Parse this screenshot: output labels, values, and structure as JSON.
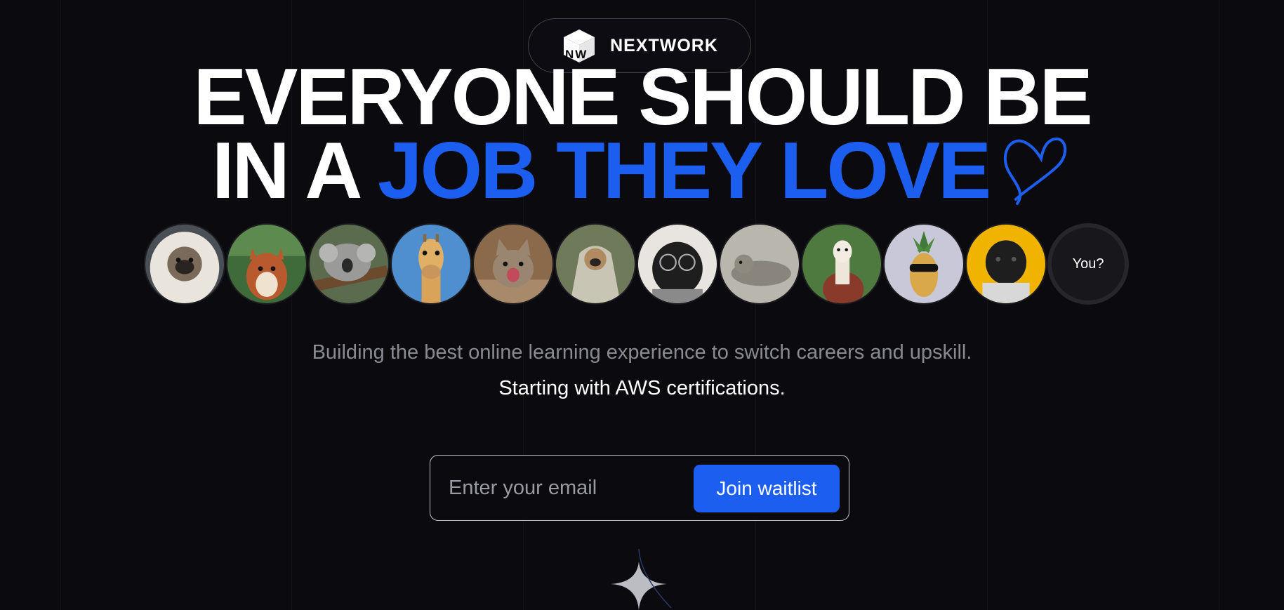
{
  "brand": {
    "name": "NEXTWORK",
    "mark_letters": "NW"
  },
  "hero": {
    "line1": "EVERYONE SHOULD BE",
    "line2_prefix": "IN A ",
    "line2_highlight": "JOB THEY LOVE"
  },
  "avatars": [
    {
      "name": "pug-in-fur-hood"
    },
    {
      "name": "squirrel"
    },
    {
      "name": "sleeping-koala"
    },
    {
      "name": "giraffe"
    },
    {
      "name": "yawning-kitten"
    },
    {
      "name": "pug-in-blanket"
    },
    {
      "name": "pug-with-glasses"
    },
    {
      "name": "seal"
    },
    {
      "name": "alpaca"
    },
    {
      "name": "pineapple-with-sunglasses"
    },
    {
      "name": "pug-in-sweater"
    }
  ],
  "you_label": "You?",
  "subtitle": "Building the best online learning experience to switch careers and upskill.",
  "tagline": "Starting with AWS certifications.",
  "form": {
    "email_placeholder": "Enter your email",
    "button_label": "Join waitlist"
  },
  "colors": {
    "background": "#0a0a0f",
    "accent": "#1b5ef0",
    "muted_text": "#8a8a92"
  }
}
